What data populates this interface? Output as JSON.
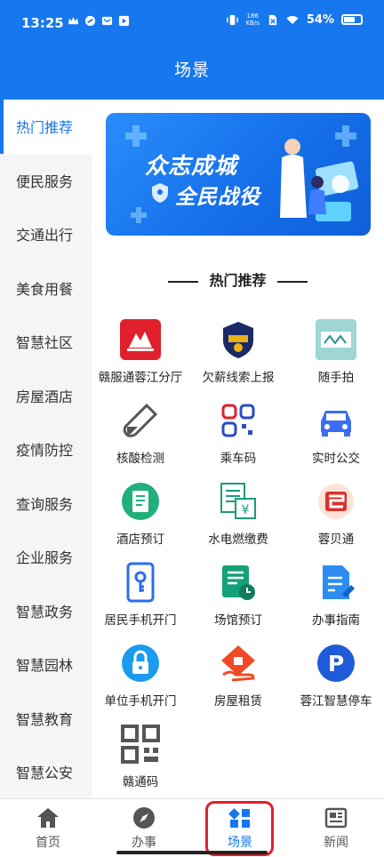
{
  "status_bar": {
    "time": "13:25",
    "net_speed_value": "186",
    "net_speed_unit": "KB/s",
    "battery": "54%"
  },
  "header": {
    "title": "场景"
  },
  "sidebar": {
    "items": [
      {
        "label": "热门推荐",
        "active": true
      },
      {
        "label": "便民服务"
      },
      {
        "label": "交通出行"
      },
      {
        "label": "美食用餐"
      },
      {
        "label": "智慧社区"
      },
      {
        "label": "房屋酒店"
      },
      {
        "label": "疫情防控"
      },
      {
        "label": "查询服务"
      },
      {
        "label": "企业服务"
      },
      {
        "label": "智慧政务"
      },
      {
        "label": "智慧园林"
      },
      {
        "label": "智慧教育"
      },
      {
        "label": "智慧公安"
      }
    ]
  },
  "banner": {
    "line1": "众志成城",
    "line2": "全民战役"
  },
  "section": {
    "title": "热门推荐"
  },
  "services": [
    {
      "label": "赣服通蓉江分厅",
      "icon": "ganfutong-logo-icon"
    },
    {
      "label": "欠薪线索上报",
      "icon": "police-badge-icon"
    },
    {
      "label": "随手拍",
      "icon": "snapshot-icon"
    },
    {
      "label": "核酸检测",
      "icon": "test-tube-icon"
    },
    {
      "label": "乘车码",
      "icon": "qr-code-icon"
    },
    {
      "label": "实时公交",
      "icon": "car-icon"
    },
    {
      "label": "酒店预订",
      "icon": "document-icon"
    },
    {
      "label": "水电燃缴费",
      "icon": "bill-icon"
    },
    {
      "label": "蓉贝通",
      "icon": "rongbei-icon"
    },
    {
      "label": "居民手机开门",
      "icon": "phone-key-icon"
    },
    {
      "label": "场馆预订",
      "icon": "venue-booking-icon"
    },
    {
      "label": "办事指南",
      "icon": "guide-icon"
    },
    {
      "label": "单位手机开门",
      "icon": "lock-icon"
    },
    {
      "label": "房屋租赁",
      "icon": "house-rental-icon"
    },
    {
      "label": "蓉江智慧停车",
      "icon": "parking-icon"
    },
    {
      "label": "赣通码",
      "icon": "ganton-qr-icon"
    }
  ],
  "bottom_nav": {
    "items": [
      {
        "label": "首页",
        "icon": "home-icon"
      },
      {
        "label": "办事",
        "icon": "compass-icon"
      },
      {
        "label": "场景",
        "icon": "grid-icon",
        "active": true
      },
      {
        "label": "新闻",
        "icon": "newspaper-icon"
      }
    ]
  },
  "colors": {
    "primary": "#1677ee",
    "highlight": "#e0202c"
  }
}
